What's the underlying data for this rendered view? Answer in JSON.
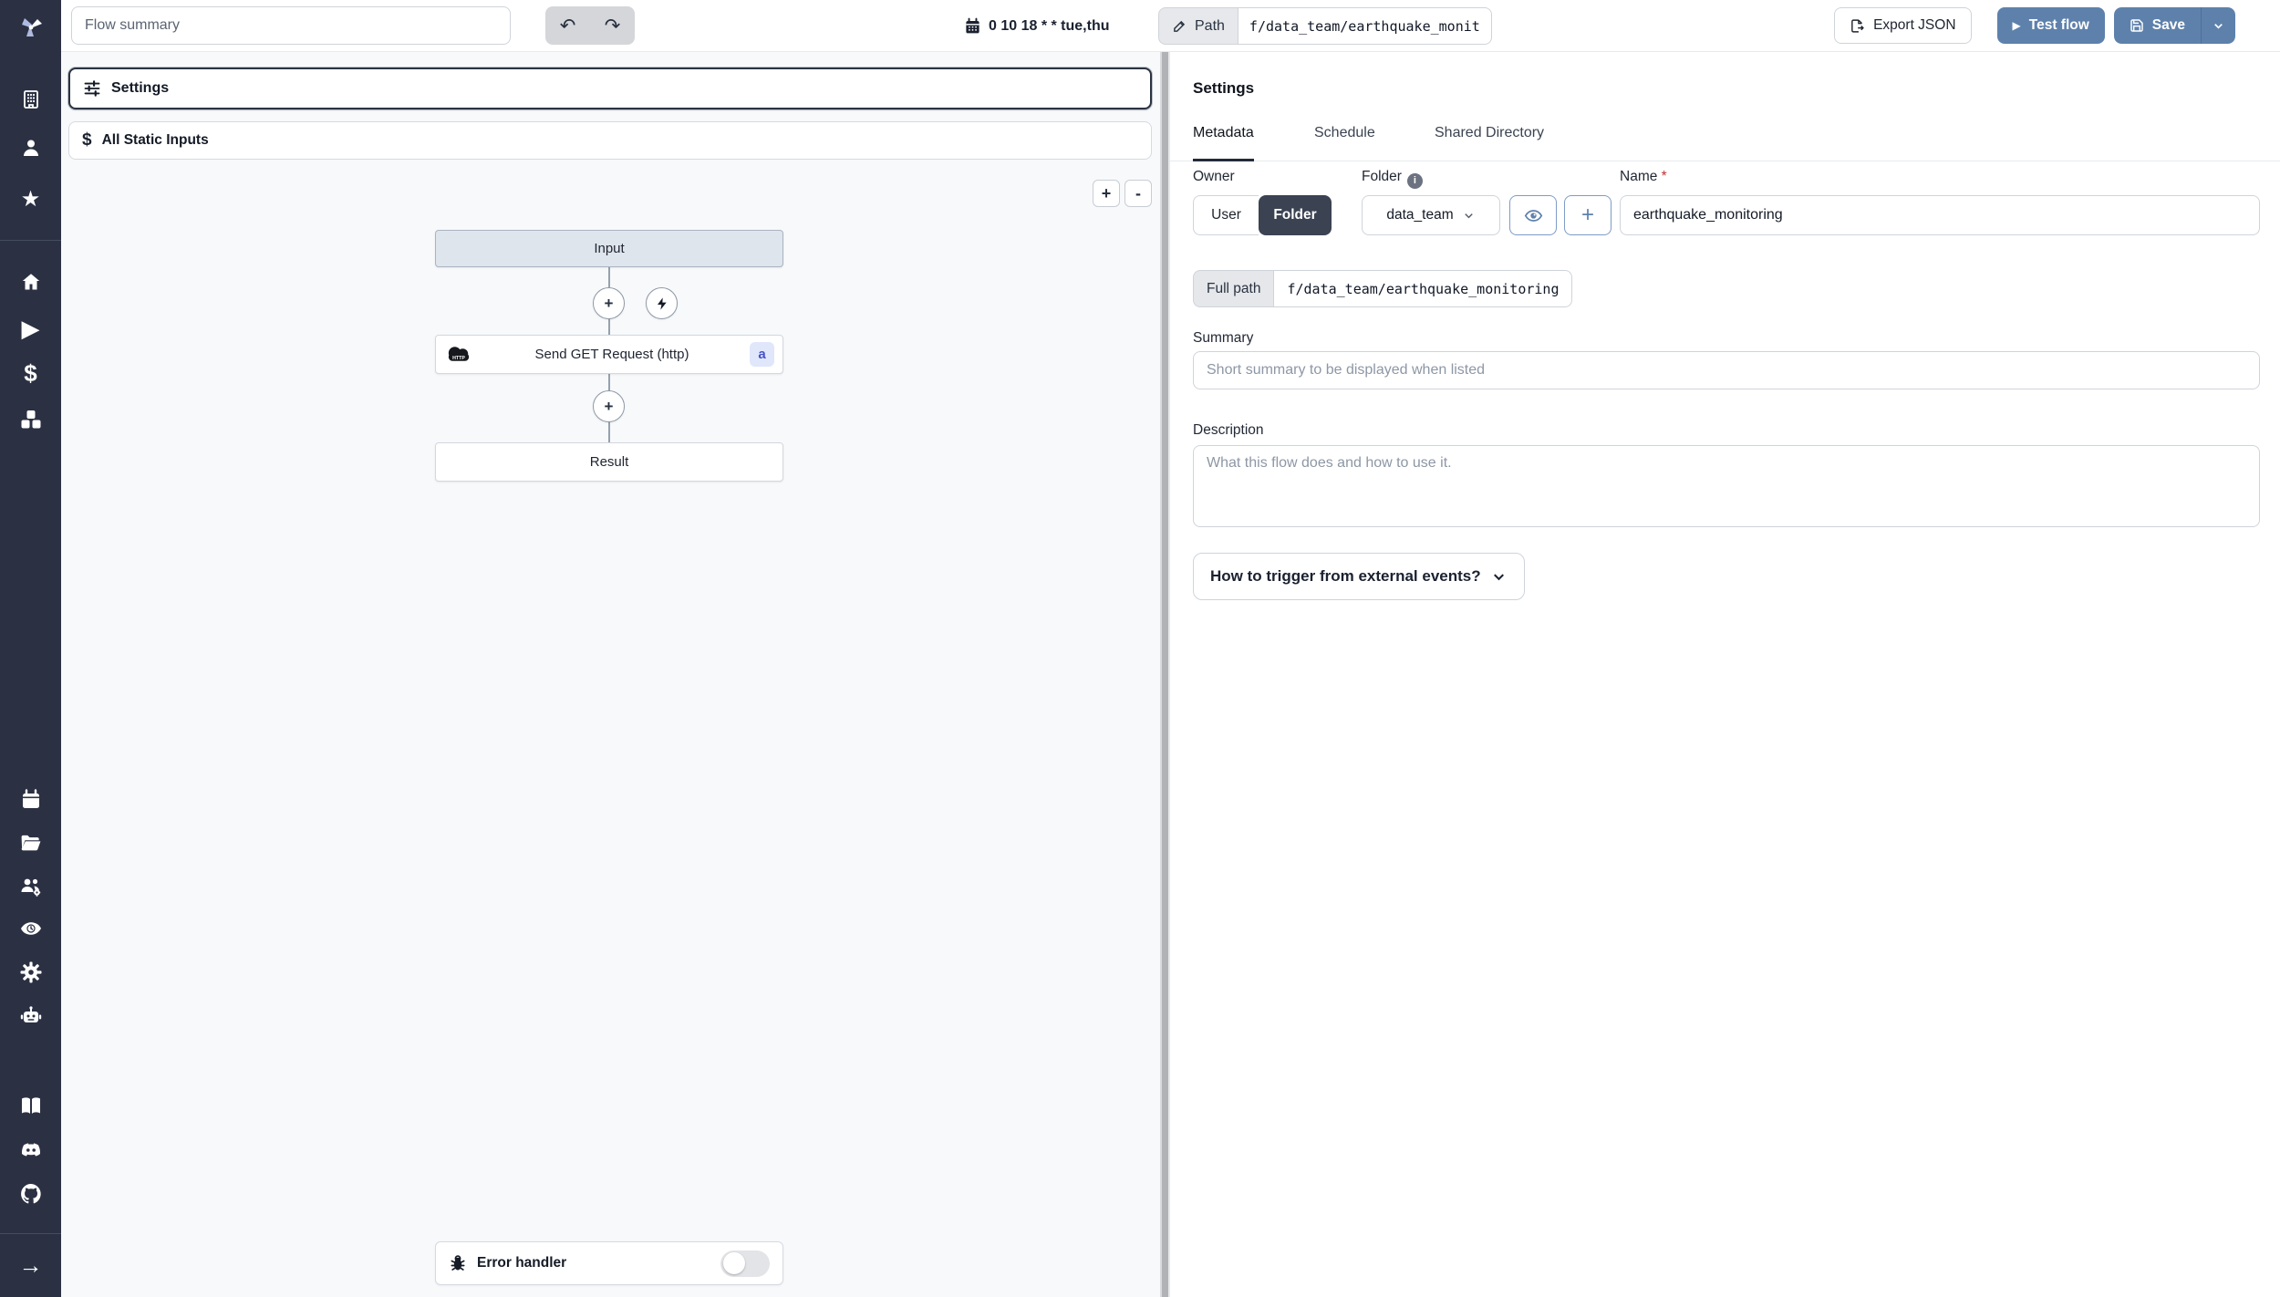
{
  "colors": {
    "accent": "#5e81ac",
    "sidebar_bg": "#2b3143",
    "selected_border": "#2a3342",
    "step_badge_bg": "#e0e7fb",
    "step_badge_text": "#4553c8",
    "folder_toggle_bg": "#3b4252"
  },
  "topbar": {
    "summary_placeholder": "Flow summary",
    "undo": "↶",
    "redo": "↷",
    "cron": "0 10 18 * * tue,thu",
    "path_label": "Path",
    "path_value": "f/data_team/earthquake_monit",
    "export_json_label": "Export JSON",
    "test_flow_label": "Test flow",
    "save_label": "Save"
  },
  "graph": {
    "settings_label": "Settings",
    "static_inputs_label": "All Static Inputs",
    "zoom_in": "+",
    "zoom_out": "-",
    "input_node": "Input",
    "step_node": "Send GET Request (http)",
    "step_badge": "a",
    "step_icon_text": "HTTP",
    "result_node": "Result",
    "error_handler_label": "Error handler"
  },
  "panel": {
    "title": "Settings",
    "tabs": [
      "Metadata",
      "Schedule",
      "Shared Directory"
    ],
    "owner_label": "Owner",
    "owner_user": "User",
    "owner_folder": "Folder",
    "folder_label": "Folder",
    "folder_value": "data_team",
    "name_label": "Name",
    "name_required": "*",
    "name_value": "earthquake_monitoring",
    "full_path_label": "Full path",
    "full_path_value": "f/data_team/earthquake_monitoring",
    "summary_label": "Summary",
    "summary_placeholder": "Short summary to be displayed when listed",
    "description_label": "Description",
    "description_placeholder": "What this flow does and how to use it.",
    "trigger_button_label": "How to trigger from external events?"
  },
  "icons": {
    "dollar": "$",
    "star": "★",
    "play": "▶",
    "arrow_right": "→",
    "plus": "+"
  }
}
